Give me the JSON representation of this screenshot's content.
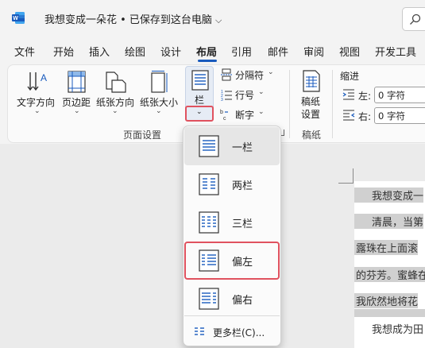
{
  "titlebar": {
    "doc_title": "我想变成一朵花 • 已保存到这台电脑",
    "chevron": "⌵"
  },
  "menu": {
    "tabs": [
      "文件",
      "开始",
      "插入",
      "绘图",
      "设计",
      "布局",
      "引用",
      "邮件",
      "审阅",
      "视图",
      "开发工具"
    ],
    "active": "布局"
  },
  "ribbon": {
    "text_direction": "文字方向",
    "margins": "页边距",
    "orientation": "纸张方向",
    "size": "纸张大小",
    "columns": "栏",
    "breaks": "分隔符",
    "line_numbers": "行号",
    "hyphenation": "断字",
    "manuscript_setup_line1": "稿纸",
    "manuscript_setup_line2": "设置",
    "page_setup_group": "页面设置",
    "manuscript_group": "稿纸",
    "indent_header": "缩进",
    "indent_left_label": "左:",
    "indent_left_value": "0 字符",
    "indent_right_label": "右:",
    "indent_right_value": "0 字符",
    "dropdown_chevron": "⌄"
  },
  "columns_menu": {
    "items": [
      "一栏",
      "两栏",
      "三栏",
      "偏左",
      "偏右"
    ],
    "selected": "一栏",
    "focused": "偏左",
    "more": "更多栏(C)..."
  },
  "document": {
    "lines": [
      "我想变成一",
      "清晨，当第",
      "露珠在上面滚",
      "的芬芳。蜜蜂在",
      "我欣然地将花",
      "我想成为田"
    ]
  }
}
